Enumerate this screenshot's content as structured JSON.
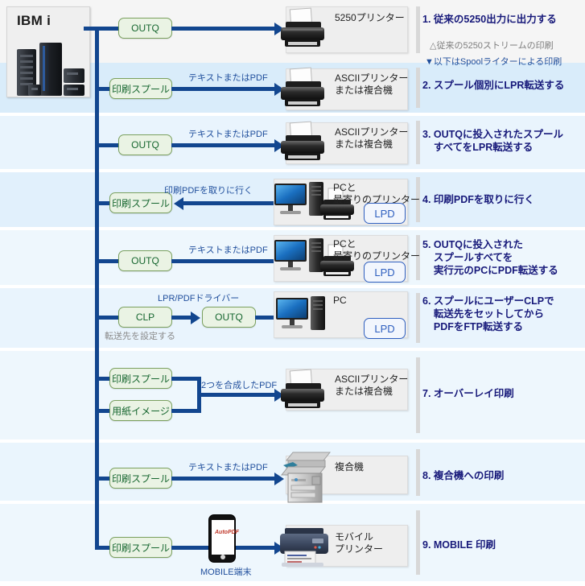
{
  "source": {
    "title": "IBM i",
    "icon": "server-rack-icon"
  },
  "rows": [
    {
      "id": 1,
      "band": "#f5f5f5",
      "nodes": [
        "OUTQ"
      ],
      "arrow_label": "",
      "device_label": "5250プリンター",
      "device_icon": "inkjet-printer-icon",
      "badge": "",
      "desc": "1. 従来の5250出力に出力する"
    },
    {
      "id": 2,
      "band": "#ddeefb",
      "nodes": [
        "印刷スプール"
      ],
      "arrow_label": "テキストまたはPDF",
      "device_label": "ASCIIプリンター\nまたは複合機",
      "device_icon": "inkjet-printer-icon",
      "badge": "",
      "desc": "2. スプール個別にLPR転送する"
    },
    {
      "id": 3,
      "band": "#e9f4fd",
      "nodes": [
        "OUTQ"
      ],
      "arrow_label": "テキストまたはPDF",
      "device_label": "ASCIIプリンター\nまたは複合機",
      "device_icon": "inkjet-printer-icon",
      "badge": "",
      "desc": "3. OUTQに投入されたスプール\n    すべてをLPR転送する"
    },
    {
      "id": 4,
      "band": "#e4f1fc",
      "nodes": [
        "印刷スプール"
      ],
      "arrow_label": "印刷PDFを取りに行く",
      "arrow_direction": "left",
      "device_label": "PCと\n最寄りのプリンター",
      "device_icon": "pc-and-printer-icon",
      "badge": "LPD",
      "desc": "4. 印刷PDFを取りに行く"
    },
    {
      "id": 5,
      "band": "#eef7fd",
      "nodes": [
        "OUTQ"
      ],
      "arrow_label": "テキストまたはPDF",
      "device_label": "PCと\n最寄りのプリンター",
      "device_icon": "pc-and-printer-icon",
      "badge": "LPD",
      "desc": "5. OUTQに投入された\n    スプールすべてを\n    実行元のPCにPDF転送する"
    },
    {
      "id": 6,
      "band": "#e9f4fd",
      "nodes": [
        "CLP",
        "OUTQ"
      ],
      "arrow_label": "LPR/PDFドライバー",
      "sub_label": "転送先を設定する",
      "device_label": "PC",
      "device_icon": "pc-icon",
      "badge": "LPD",
      "desc": "6. スプールにユーザーCLPで\n    転送先をセットしてから\n    PDFをFTP転送する"
    },
    {
      "id": 7,
      "band": "#eef7fd",
      "nodes": [
        "印刷スプール",
        "用紙イメージ"
      ],
      "arrow_label": "2つを合成したPDF",
      "device_label": "ASCIIプリンター\nまたは複合機",
      "device_icon": "inkjet-printer-icon",
      "badge": "",
      "desc": "7. オーバーレイ印刷"
    },
    {
      "id": 8,
      "band": "#eaf5fd",
      "nodes": [
        "印刷スプール"
      ],
      "arrow_label": "テキストまたはPDF",
      "device_label": "複合機",
      "device_icon": "mfp-copier-icon",
      "badge": "",
      "desc": "8. 複合機への印刷"
    },
    {
      "id": 9,
      "band": "#eef7fd",
      "nodes": [
        "印刷スプール"
      ],
      "arrow_label": "",
      "device_label": "モバイル\nプリンター",
      "device_icon": "mobile-printer-icon",
      "badge": "",
      "mobile_label": "MOBILE端末",
      "desc": "9. MOBILE 印刷"
    }
  ],
  "notes": {
    "gray_note": "△従来の5250ストリームの印刷",
    "blue_note": "▼以下はSpoolライターによる印刷"
  },
  "colors": {
    "connector": "#12468f",
    "node_fill": "#eaf3e4",
    "node_border": "#7aa05e",
    "node_text": "#16662f",
    "caption": "#1f4e9c",
    "desc_text": "#17197a",
    "badge": "#2f5fbf"
  }
}
